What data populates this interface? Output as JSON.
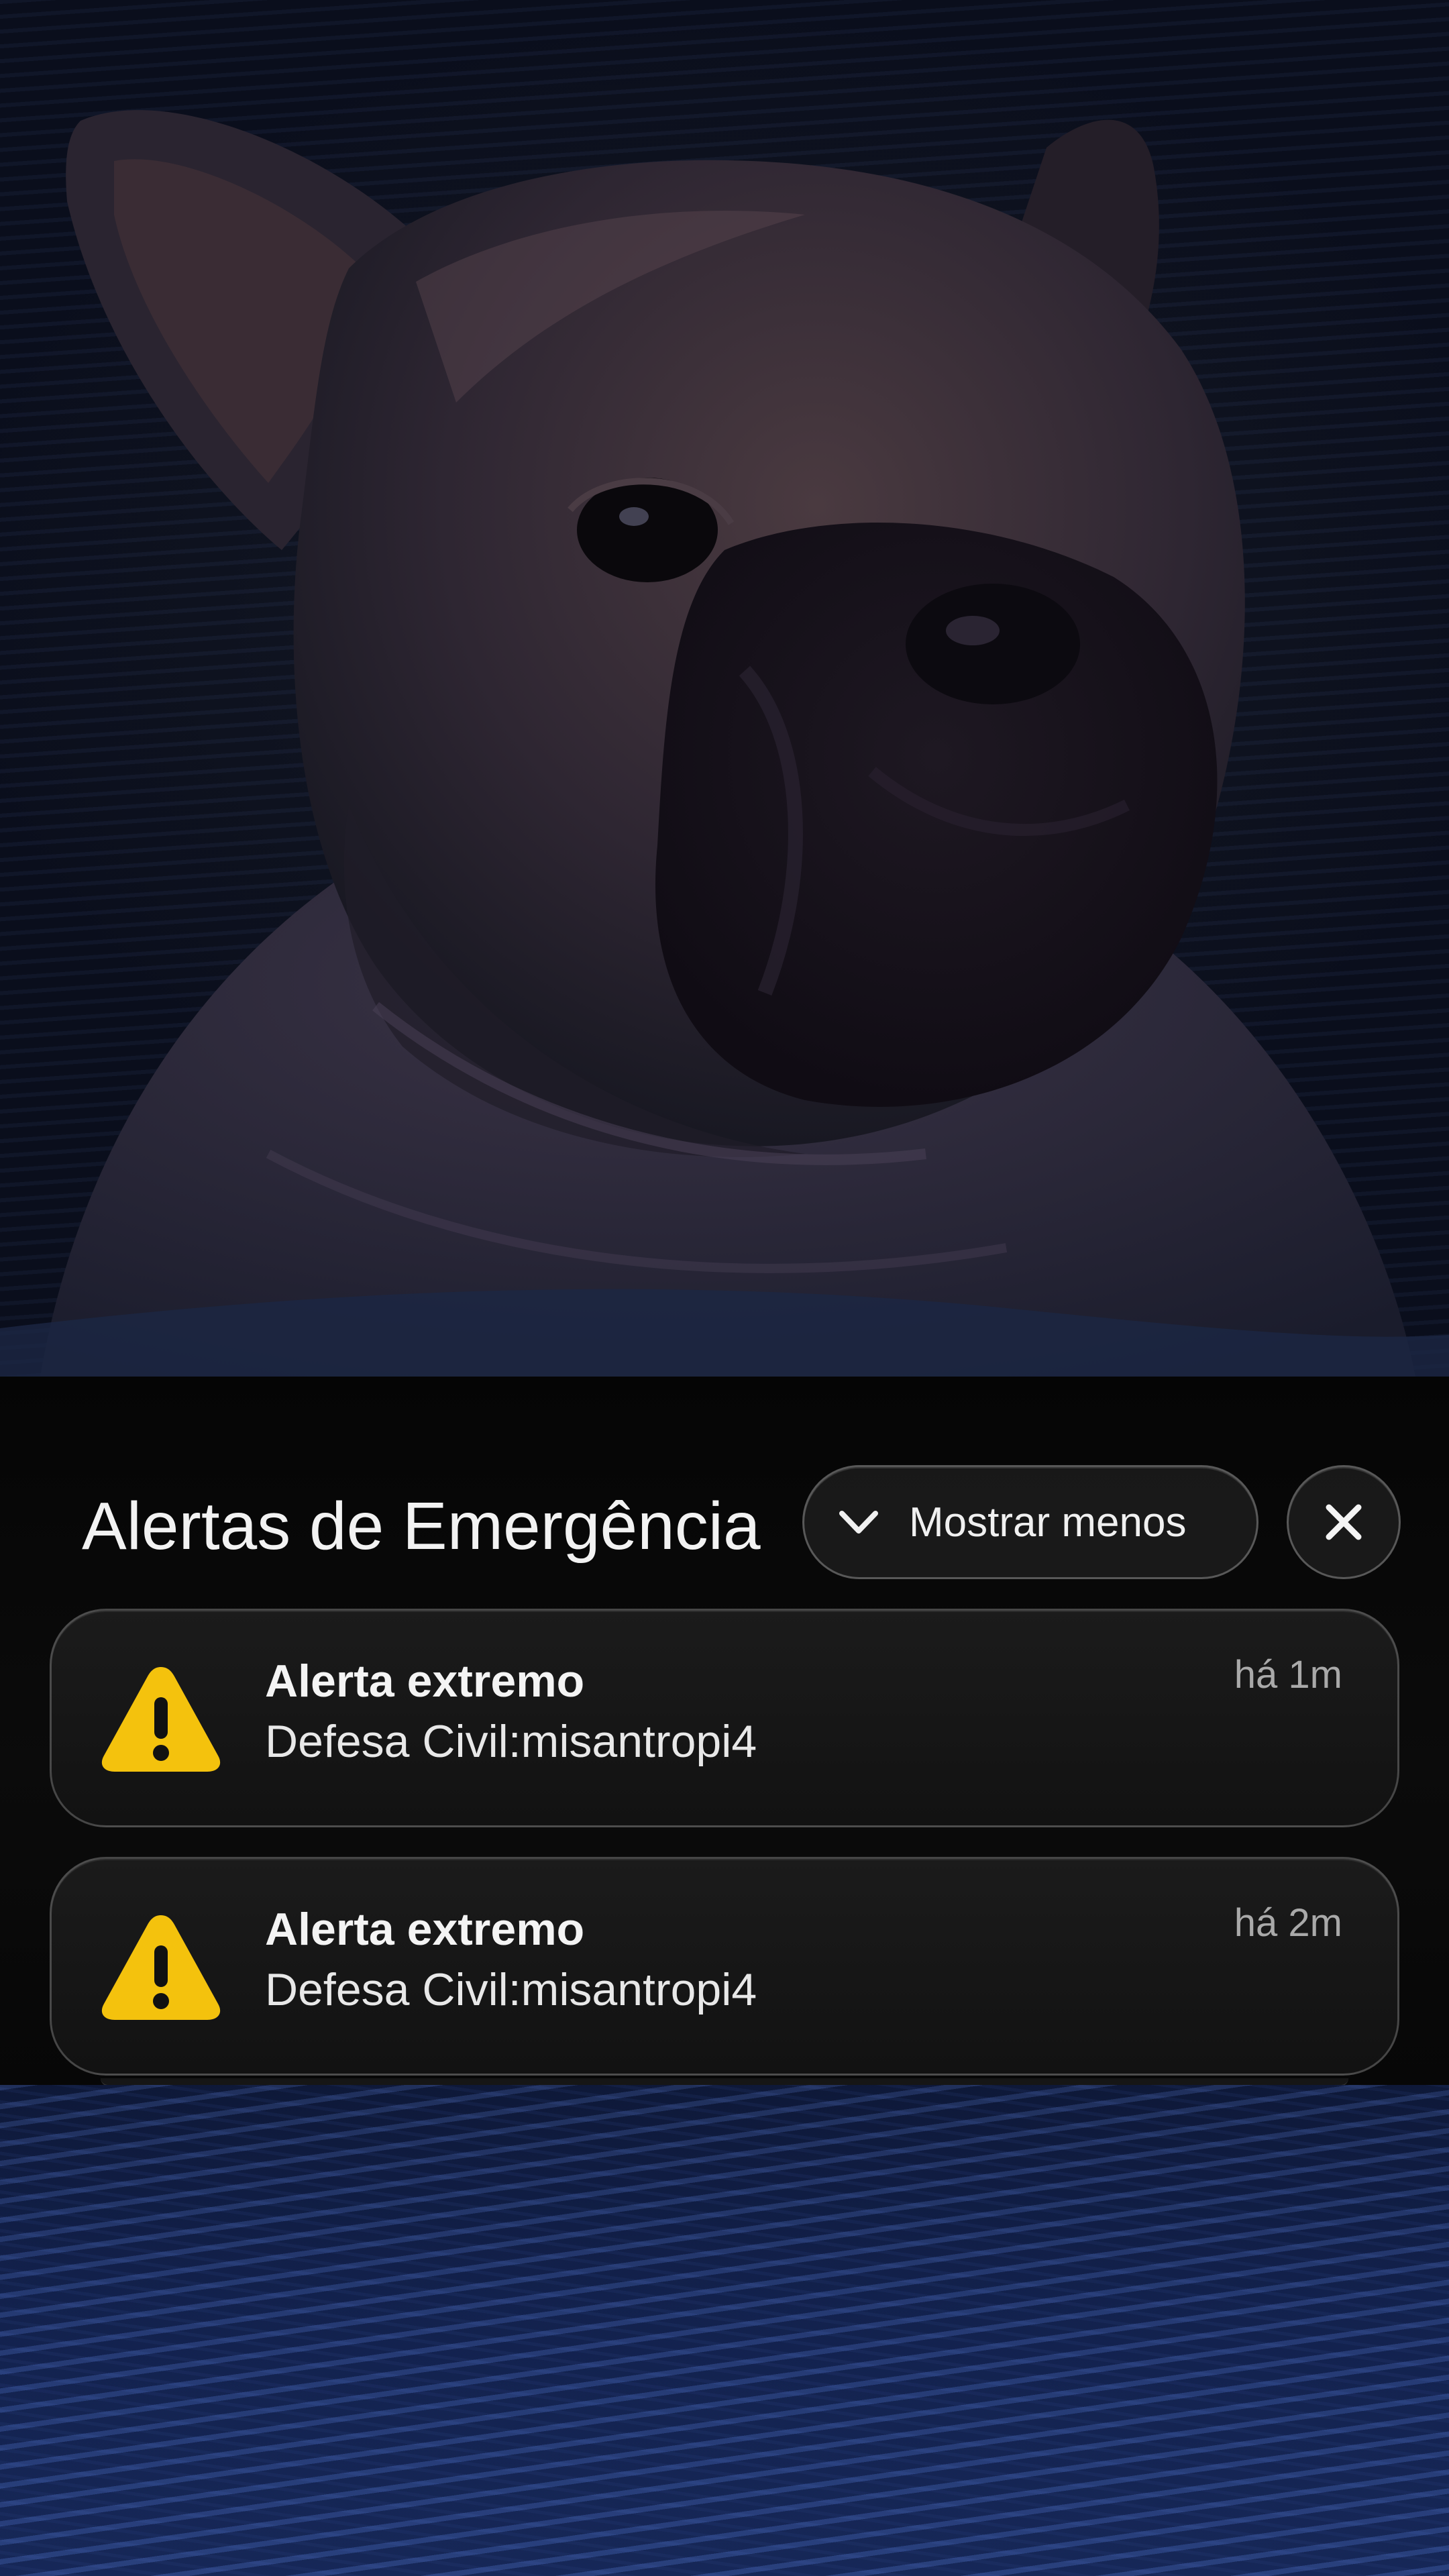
{
  "alert_panel": {
    "title": "Alertas de Emergência",
    "show_less_label": "Mostrar menos",
    "icons": {
      "show_less": "chevron-down-icon",
      "close": "close-icon",
      "alert": "warning-triangle-icon"
    },
    "colors": {
      "warning": "#f4c20d",
      "text": "#f2f2f2",
      "timestamp": "#a9a9a9"
    },
    "notifications": [
      {
        "title": "Alerta extremo",
        "body": "Defesa Civil:misantropi4",
        "time": "há 1m"
      },
      {
        "title": "Alerta extremo",
        "body": "Defesa Civil:misantropi4",
        "time": "há 2m"
      }
    ]
  }
}
